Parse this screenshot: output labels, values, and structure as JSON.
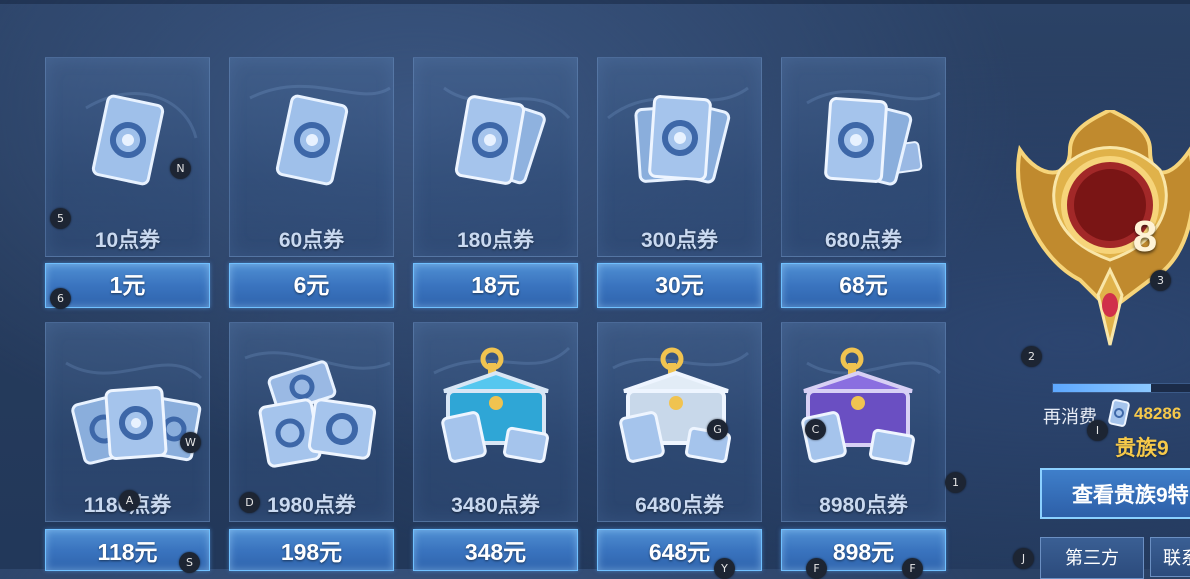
{
  "products": [
    {
      "amount": "10点券",
      "price": "1元",
      "art": "single-ticket-icon"
    },
    {
      "amount": "60点券",
      "price": "6元",
      "art": "single-ticket-icon"
    },
    {
      "amount": "180点券",
      "price": "18元",
      "art": "ticket-pair-icon"
    },
    {
      "amount": "300点券",
      "price": "30元",
      "art": "ticket-fan-icon"
    },
    {
      "amount": "680点券",
      "price": "68元",
      "art": "ticket-stack-icon"
    },
    {
      "amount": "1180点券",
      "price": "118元",
      "art": "ticket-pile-icon"
    },
    {
      "amount": "1980点券",
      "price": "198元",
      "art": "ticket-heap-icon"
    },
    {
      "amount": "3480点券",
      "price": "348元",
      "art": "blue-chest-icon"
    },
    {
      "amount": "6480点券",
      "price": "648元",
      "art": "silver-chest-icon"
    },
    {
      "amount": "8980点券",
      "price": "898元",
      "art": "purple-chest-icon"
    }
  ],
  "vip": {
    "badge_level": "8",
    "progress_fraction": 0.7,
    "spend_label": "再消费",
    "spend_value": "48286",
    "next_level": "贵族9",
    "view_button": "查看贵族9特",
    "third_party_button": "第三方",
    "contact_button": "联系"
  },
  "markers": [
    "N",
    "5",
    "6",
    "W",
    "A",
    "D",
    "S",
    "G",
    "C",
    "1",
    "2",
    "3",
    "I",
    "J",
    "Y",
    "F",
    "F"
  ],
  "colors": {
    "accent": "#4f8fd3",
    "gold": "#f6c94a",
    "card_text": "#c9d9f0"
  }
}
